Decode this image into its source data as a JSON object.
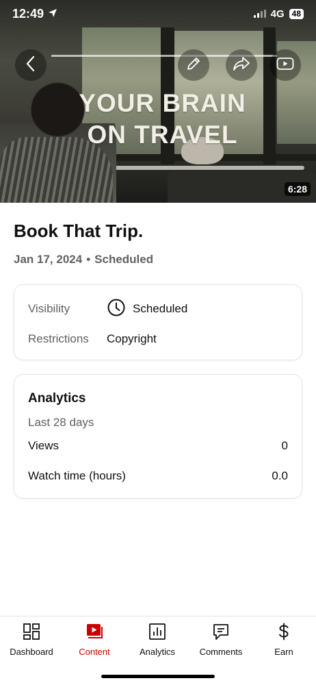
{
  "status_bar": {
    "time": "12:49",
    "network": "4G",
    "battery": "48"
  },
  "thumbnail": {
    "title_text": "YOUR BRAIN ON TRAVEL",
    "duration": "6:28",
    "scrub_progress": 1.0
  },
  "video": {
    "title": "Book That Trip.",
    "date": "Jan 17, 2024",
    "separator": "•",
    "status": "Scheduled"
  },
  "info_card": {
    "visibility_label": "Visibility",
    "visibility_value": "Scheduled",
    "restrictions_label": "Restrictions",
    "restrictions_value": "Copyright"
  },
  "analytics_card": {
    "title": "Analytics",
    "period": "Last 28 days",
    "rows": [
      {
        "label": "Views",
        "value": "0"
      },
      {
        "label": "Watch time (hours)",
        "value": "0.0"
      }
    ]
  },
  "bottom_nav": {
    "items": [
      {
        "label": "Dashboard",
        "icon": "dashboard-icon",
        "active": false
      },
      {
        "label": "Content",
        "icon": "content-icon",
        "active": true
      },
      {
        "label": "Analytics",
        "icon": "analytics-icon",
        "active": false
      },
      {
        "label": "Comments",
        "icon": "comments-icon",
        "active": false
      },
      {
        "label": "Earn",
        "icon": "earn-icon",
        "active": false
      }
    ]
  },
  "colors": {
    "accent": "#cc0000",
    "secondary_text": "#606060",
    "primary_text": "#0f0f0f"
  }
}
